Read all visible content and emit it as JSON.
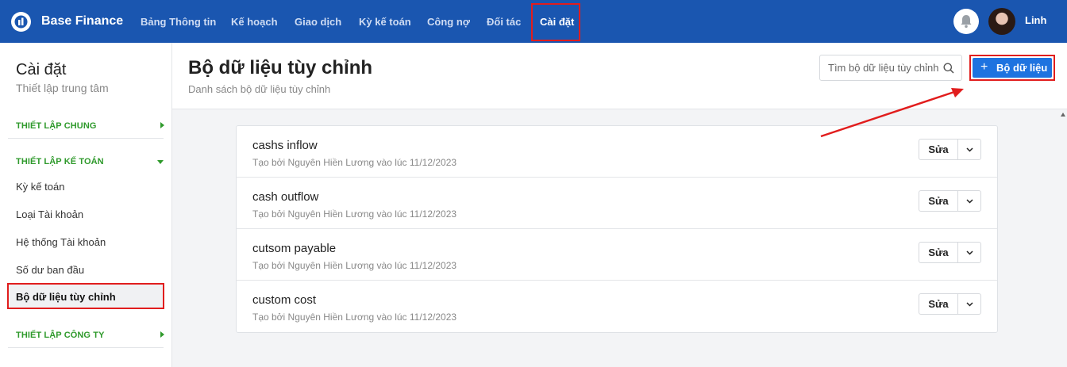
{
  "app": {
    "brand": "Base Finance"
  },
  "nav": {
    "items": [
      "Bảng Thông tin",
      "Kế hoạch",
      "Giao dịch",
      "Kỳ kế toán",
      "Công nợ",
      "Đối tác",
      "Cài đặt"
    ],
    "active": "Cài đặt"
  },
  "user": {
    "name": "Linh"
  },
  "sidebar": {
    "title": "Cài đặt",
    "subtitle": "Thiết lập trung tâm",
    "sections": {
      "general": "THIẾT LẬP CHUNG",
      "accounting": "THIẾT LẬP KẾ TOÁN",
      "company": "THIẾT LẬP CÔNG TY"
    },
    "items": [
      "Kỳ kế toán",
      "Loại Tài khoản",
      "Hệ thống Tài khoản",
      "Số dư ban đầu",
      "Bộ dữ liệu tùy chỉnh"
    ],
    "active": "Bộ dữ liệu tùy chỉnh"
  },
  "page": {
    "title": "Bộ dữ liệu tùy chỉnh",
    "subtitle": "Danh sách bộ dữ liệu tùy chỉnh",
    "search_placeholder": "Tìm bộ dữ liệu tùy chỉnh",
    "add_label": "Bộ dữ liệu"
  },
  "datasets": [
    {
      "name": "cashs inflow",
      "meta": "Tạo bởi Nguyên Hiền Lương vào lúc 11/12/2023",
      "edit": "Sửa"
    },
    {
      "name": "cash outflow",
      "meta": "Tạo bởi Nguyên Hiền Lương vào lúc 11/12/2023",
      "edit": "Sửa"
    },
    {
      "name": "cutsom payable",
      "meta": "Tạo bởi Nguyên Hiền Lương vào lúc 11/12/2023",
      "edit": "Sửa"
    },
    {
      "name": "custom cost",
      "meta": "Tạo bởi Nguyên Hiền Lương vào lúc 11/12/2023",
      "edit": "Sửa"
    }
  ],
  "colors": {
    "header": "#1a56b0",
    "accent": "#1e73e0",
    "section": "#2f9a2c",
    "highlight": "#e11d1d"
  }
}
